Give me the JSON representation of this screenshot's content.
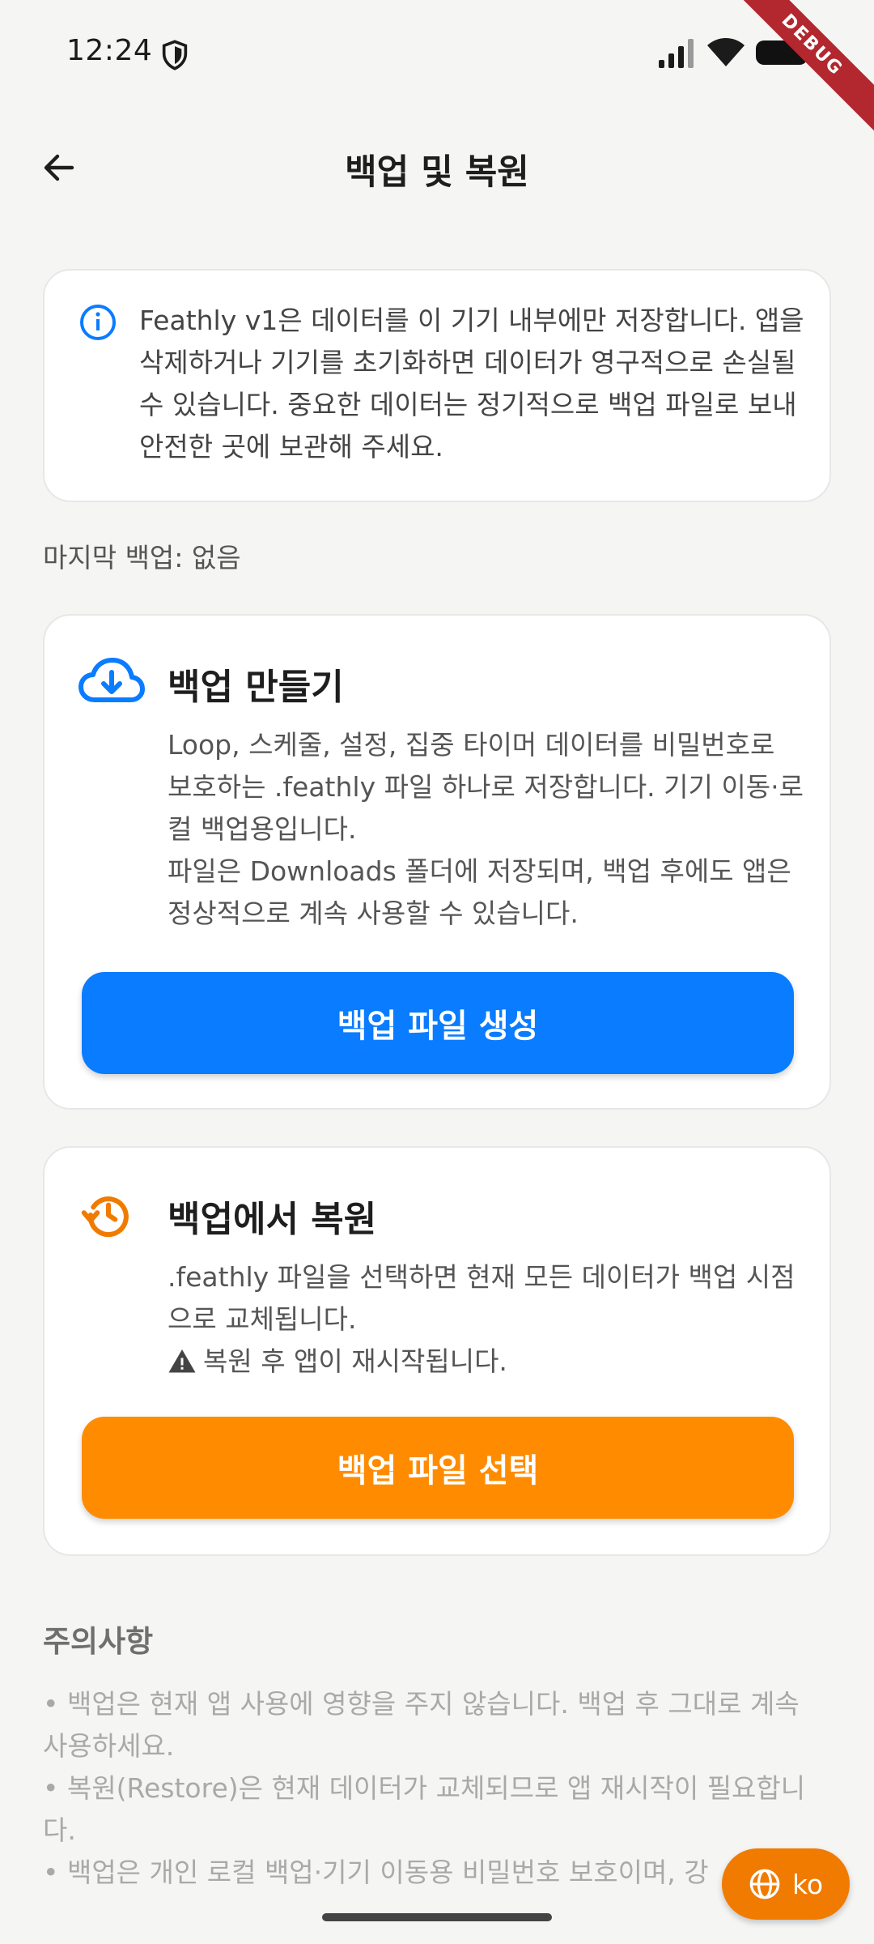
{
  "status_bar": {
    "time": "12:24",
    "debug_label": "DEBUG"
  },
  "app_bar": {
    "title": "백업 및 복원"
  },
  "info_card": {
    "text": "Feathly v1은 데이터를 이 기기 내부에만 저장합니다. 앱을 삭제하거나 기기를 초기화하면 데이터가 영구적으로 손실될 수 있습니다. 중요한 데이터는 정기적으로 백업 파일로 보내 안전한 곳에 보관해 주세요.",
    "icon": "info-icon"
  },
  "last_backup": "마지막 백업: 없음",
  "backup_card": {
    "icon": "cloud-download-icon",
    "title": "백업 만들기",
    "desc_line1": "Loop, 스케줄, 설정, 집중 타이머 데이터를 비밀번호로 보호하는 .feathly 파일 하나로 저장합니다. 기기 이동·로컬 백업용입니다.",
    "desc_line2": "파일은 Downloads 폴더에 저장되며, 백업 후에도 앱은 정상적으로 계속 사용할 수 있습니다.",
    "button_label": "백업 파일 생성",
    "button_color": "#0a7cff"
  },
  "restore_card": {
    "icon": "history-icon",
    "title": "백업에서 복원",
    "desc_line1": ".feathly 파일을 선택하면 현재 모든 데이터가 백업 시점으로 교체됩니다.",
    "warning": "복원 후 앱이 재시작됩니다.",
    "button_label": "백업 파일 선택",
    "button_color": "#ff8c00"
  },
  "notes": {
    "title": "주의사항",
    "items": [
      "• 백업은 현재 앱 사용에 영향을 주지 않습니다. 백업 후 그대로 계속 사용하세요.",
      "• 복원(Restore)은 현재 데이터가 교체되므로 앱 재시작이 필요합니다.",
      "• 백업은 개인 로컬 백업·기기 이동용 비밀번호 보호이며, 강"
    ]
  },
  "language_fab": {
    "label": "ko",
    "icon": "globe-icon"
  }
}
